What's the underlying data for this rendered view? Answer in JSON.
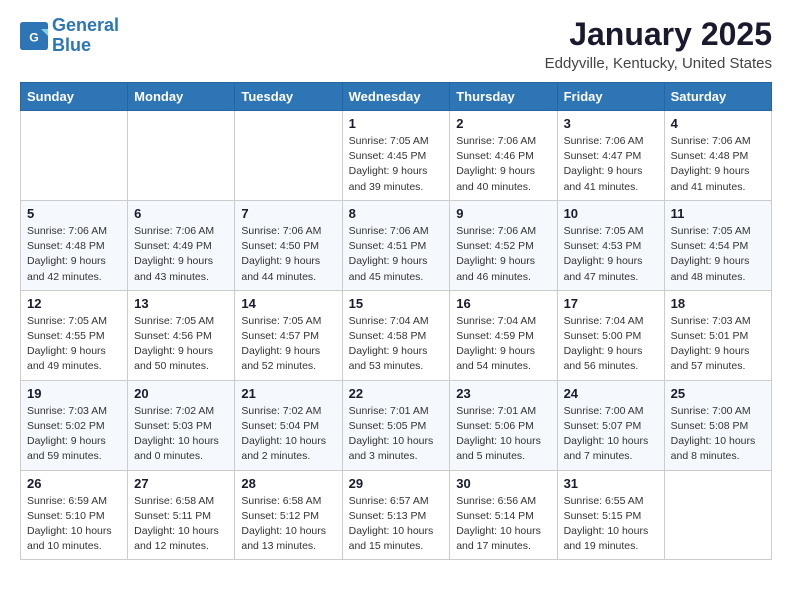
{
  "logo": {
    "line1": "General",
    "line2": "Blue"
  },
  "title": "January 2025",
  "location": "Eddyville, Kentucky, United States",
  "days_header": [
    "Sunday",
    "Monday",
    "Tuesday",
    "Wednesday",
    "Thursday",
    "Friday",
    "Saturday"
  ],
  "weeks": [
    [
      {
        "day": "",
        "info": ""
      },
      {
        "day": "",
        "info": ""
      },
      {
        "day": "",
        "info": ""
      },
      {
        "day": "1",
        "info": "Sunrise: 7:05 AM\nSunset: 4:45 PM\nDaylight: 9 hours\nand 39 minutes."
      },
      {
        "day": "2",
        "info": "Sunrise: 7:06 AM\nSunset: 4:46 PM\nDaylight: 9 hours\nand 40 minutes."
      },
      {
        "day": "3",
        "info": "Sunrise: 7:06 AM\nSunset: 4:47 PM\nDaylight: 9 hours\nand 41 minutes."
      },
      {
        "day": "4",
        "info": "Sunrise: 7:06 AM\nSunset: 4:48 PM\nDaylight: 9 hours\nand 41 minutes."
      }
    ],
    [
      {
        "day": "5",
        "info": "Sunrise: 7:06 AM\nSunset: 4:48 PM\nDaylight: 9 hours\nand 42 minutes."
      },
      {
        "day": "6",
        "info": "Sunrise: 7:06 AM\nSunset: 4:49 PM\nDaylight: 9 hours\nand 43 minutes."
      },
      {
        "day": "7",
        "info": "Sunrise: 7:06 AM\nSunset: 4:50 PM\nDaylight: 9 hours\nand 44 minutes."
      },
      {
        "day": "8",
        "info": "Sunrise: 7:06 AM\nSunset: 4:51 PM\nDaylight: 9 hours\nand 45 minutes."
      },
      {
        "day": "9",
        "info": "Sunrise: 7:06 AM\nSunset: 4:52 PM\nDaylight: 9 hours\nand 46 minutes."
      },
      {
        "day": "10",
        "info": "Sunrise: 7:05 AM\nSunset: 4:53 PM\nDaylight: 9 hours\nand 47 minutes."
      },
      {
        "day": "11",
        "info": "Sunrise: 7:05 AM\nSunset: 4:54 PM\nDaylight: 9 hours\nand 48 minutes."
      }
    ],
    [
      {
        "day": "12",
        "info": "Sunrise: 7:05 AM\nSunset: 4:55 PM\nDaylight: 9 hours\nand 49 minutes."
      },
      {
        "day": "13",
        "info": "Sunrise: 7:05 AM\nSunset: 4:56 PM\nDaylight: 9 hours\nand 50 minutes."
      },
      {
        "day": "14",
        "info": "Sunrise: 7:05 AM\nSunset: 4:57 PM\nDaylight: 9 hours\nand 52 minutes."
      },
      {
        "day": "15",
        "info": "Sunrise: 7:04 AM\nSunset: 4:58 PM\nDaylight: 9 hours\nand 53 minutes."
      },
      {
        "day": "16",
        "info": "Sunrise: 7:04 AM\nSunset: 4:59 PM\nDaylight: 9 hours\nand 54 minutes."
      },
      {
        "day": "17",
        "info": "Sunrise: 7:04 AM\nSunset: 5:00 PM\nDaylight: 9 hours\nand 56 minutes."
      },
      {
        "day": "18",
        "info": "Sunrise: 7:03 AM\nSunset: 5:01 PM\nDaylight: 9 hours\nand 57 minutes."
      }
    ],
    [
      {
        "day": "19",
        "info": "Sunrise: 7:03 AM\nSunset: 5:02 PM\nDaylight: 9 hours\nand 59 minutes."
      },
      {
        "day": "20",
        "info": "Sunrise: 7:02 AM\nSunset: 5:03 PM\nDaylight: 10 hours\nand 0 minutes."
      },
      {
        "day": "21",
        "info": "Sunrise: 7:02 AM\nSunset: 5:04 PM\nDaylight: 10 hours\nand 2 minutes."
      },
      {
        "day": "22",
        "info": "Sunrise: 7:01 AM\nSunset: 5:05 PM\nDaylight: 10 hours\nand 3 minutes."
      },
      {
        "day": "23",
        "info": "Sunrise: 7:01 AM\nSunset: 5:06 PM\nDaylight: 10 hours\nand 5 minutes."
      },
      {
        "day": "24",
        "info": "Sunrise: 7:00 AM\nSunset: 5:07 PM\nDaylight: 10 hours\nand 7 minutes."
      },
      {
        "day": "25",
        "info": "Sunrise: 7:00 AM\nSunset: 5:08 PM\nDaylight: 10 hours\nand 8 minutes."
      }
    ],
    [
      {
        "day": "26",
        "info": "Sunrise: 6:59 AM\nSunset: 5:10 PM\nDaylight: 10 hours\nand 10 minutes."
      },
      {
        "day": "27",
        "info": "Sunrise: 6:58 AM\nSunset: 5:11 PM\nDaylight: 10 hours\nand 12 minutes."
      },
      {
        "day": "28",
        "info": "Sunrise: 6:58 AM\nSunset: 5:12 PM\nDaylight: 10 hours\nand 13 minutes."
      },
      {
        "day": "29",
        "info": "Sunrise: 6:57 AM\nSunset: 5:13 PM\nDaylight: 10 hours\nand 15 minutes."
      },
      {
        "day": "30",
        "info": "Sunrise: 6:56 AM\nSunset: 5:14 PM\nDaylight: 10 hours\nand 17 minutes."
      },
      {
        "day": "31",
        "info": "Sunrise: 6:55 AM\nSunset: 5:15 PM\nDaylight: 10 hours\nand 19 minutes."
      },
      {
        "day": "",
        "info": ""
      }
    ]
  ]
}
